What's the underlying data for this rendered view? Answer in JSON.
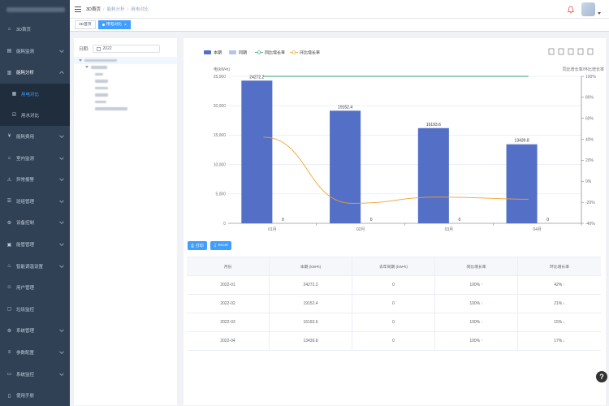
{
  "sidebar": {
    "items": [
      {
        "label": "3D首页",
        "icon": "home-icon",
        "has_arrow": false
      },
      {
        "label": "能耗监测",
        "icon": "monitor-icon",
        "has_arrow": true
      },
      {
        "label": "能耗分析",
        "icon": "bar-chart-icon",
        "has_arrow": true,
        "open": true
      },
      {
        "label": "用电对比",
        "icon": "compare-icon",
        "sub": true,
        "active": true
      },
      {
        "label": "用水对比",
        "icon": "check-square-icon",
        "sub": true
      },
      {
        "label": "能耗费用",
        "icon": "fee-icon",
        "has_arrow": true
      },
      {
        "label": "室内监测",
        "icon": "indoor-icon",
        "has_arrow": true
      },
      {
        "label": "异常报警",
        "icon": "alarm-icon",
        "has_arrow": true
      },
      {
        "label": "班组管理",
        "icon": "team-icon",
        "has_arrow": true
      },
      {
        "label": "设备控制",
        "icon": "device-icon",
        "has_arrow": true
      },
      {
        "label": "能管管理",
        "icon": "manage-icon",
        "has_arrow": true
      },
      {
        "label": "智能调温设置",
        "icon": "temperature-icon",
        "has_arrow": true
      },
      {
        "label": "用户管理",
        "icon": "user-icon",
        "has_arrow": false
      },
      {
        "label": "垃圾监控",
        "icon": "trash-icon",
        "has_arrow": false
      },
      {
        "label": "系统管理",
        "icon": "settings-icon",
        "has_arrow": true
      },
      {
        "label": "参数配置",
        "icon": "params-icon",
        "has_arrow": true
      },
      {
        "label": "系统监控",
        "icon": "system-monitor-icon",
        "has_arrow": true
      },
      {
        "label": "使用手册",
        "icon": "manual-icon",
        "has_arrow": false
      }
    ]
  },
  "breadcrumb": [
    "3D首页",
    "能耗分析",
    "用电对比"
  ],
  "tags": [
    {
      "label": "3D首页",
      "active": false
    },
    {
      "label": "用电对比",
      "active": true
    }
  ],
  "filter": {
    "date_label": "日期:",
    "date_value": "2022"
  },
  "buttons": {
    "print": "打印",
    "excel": "Excel"
  },
  "table": {
    "headers": [
      "月份",
      "本期 (kW•h)",
      "去年同期 (kW•h)",
      "同比增长率",
      "环比增长率"
    ],
    "rows": [
      {
        "month": "2022-01",
        "current": "24272.2",
        "last": "0",
        "yoy": "100%",
        "yoy_dir": "↑",
        "mom": "42%",
        "mom_dir": "↑"
      },
      {
        "month": "2022-02",
        "current": "19152.4",
        "last": "0",
        "yoy": "100%",
        "yoy_dir": "↑",
        "mom": "21%",
        "mom_dir": "↓"
      },
      {
        "month": "2022-03",
        "current": "16193.6",
        "last": "0",
        "yoy": "100%",
        "yoy_dir": "↑",
        "mom": "15%",
        "mom_dir": "↓"
      },
      {
        "month": "2022-04",
        "current": "13439.8",
        "last": "0",
        "yoy": "100%",
        "yoy_dir": "↑",
        "mom": "17%",
        "mom_dir": "↓"
      }
    ]
  },
  "chart_data": {
    "type": "bar",
    "categories": [
      "01月",
      "02月",
      "03月",
      "04月"
    ],
    "series": [
      {
        "name": "本期",
        "type": "bar",
        "values": [
          24272.2,
          19152.4,
          16193.6,
          13439.8
        ],
        "color": "#5470c6"
      },
      {
        "name": "同期",
        "type": "bar",
        "values": [
          0,
          0,
          0,
          0
        ],
        "color": "#b7c6e6"
      },
      {
        "name": "同比增长率",
        "type": "line",
        "axis": "right",
        "values": [
          100,
          100,
          100,
          100
        ],
        "color": "#3ba272"
      },
      {
        "name": "环比增长率",
        "type": "line",
        "axis": "right",
        "values": [
          42,
          -21,
          -15,
          -17
        ],
        "color": "#f0a030"
      }
    ],
    "ylabel": "电(kW•h)",
    "ylabel_right": "同比增长率/环比增长率",
    "ylim": [
      0,
      25000
    ],
    "yticks": [
      "0",
      "5,000",
      "10,000",
      "15,000",
      "20,000",
      "25,000"
    ],
    "ylim_right": [
      -40,
      100
    ],
    "yticks_right": [
      "-40%",
      "-20%",
      "0%",
      "20%",
      "40%",
      "60%",
      "80%",
      "100%"
    ],
    "bar_labels": [
      "24272.2",
      "19152.4",
      "16193.6",
      "13439.8"
    ],
    "zero_labels": [
      "0",
      "0",
      "0",
      "0"
    ],
    "legend_position": "top-left",
    "grid": true
  },
  "colors": {
    "sidebar_bg": "#304156",
    "accent": "#409eff",
    "bar": "#5470c6"
  }
}
